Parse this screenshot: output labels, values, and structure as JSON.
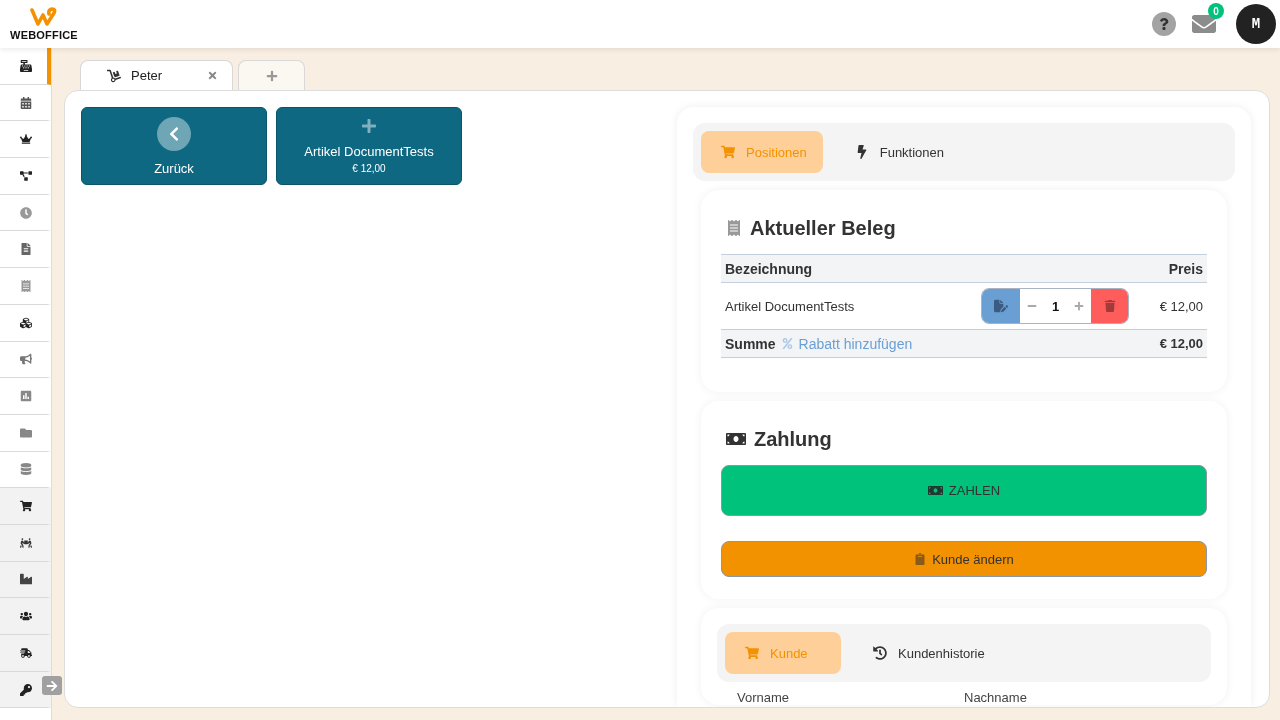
{
  "header": {
    "logo_text": "WEBOFFICE",
    "notification_count": "0",
    "avatar_initial": "M"
  },
  "sidebar": {
    "items": [
      {
        "selected": true,
        "shaded": false
      },
      {
        "selected": false,
        "shaded": false
      },
      {
        "selected": false,
        "shaded": false
      },
      {
        "selected": false,
        "shaded": false
      },
      {
        "selected": false,
        "shaded": false
      },
      {
        "selected": false,
        "shaded": false
      },
      {
        "selected": false,
        "shaded": false
      },
      {
        "selected": false,
        "shaded": false
      },
      {
        "selected": false,
        "shaded": false
      },
      {
        "selected": false,
        "shaded": false
      },
      {
        "selected": false,
        "shaded": false
      },
      {
        "selected": false,
        "shaded": false
      },
      {
        "selected": false,
        "shaded": true
      },
      {
        "selected": false,
        "shaded": true
      },
      {
        "selected": false,
        "shaded": true
      },
      {
        "selected": false,
        "shaded": true
      },
      {
        "selected": false,
        "shaded": true
      },
      {
        "selected": false,
        "shaded": true
      }
    ]
  },
  "tabs": [
    {
      "label": "Peter",
      "selected": true
    }
  ],
  "tiles": [
    {
      "kind": "back",
      "label": "Zurück"
    },
    {
      "kind": "article",
      "label": "Artikel DocumentTests",
      "price": "€ 12,00"
    }
  ],
  "panel_tabs": [
    {
      "label": "Positionen",
      "selected": true
    },
    {
      "label": "Funktionen",
      "selected": false
    }
  ],
  "receipt": {
    "title": "Aktueller Beleg",
    "columns": [
      "Bezeichnung",
      "Preis"
    ],
    "rows": [
      {
        "name": "Artikel DocumentTests",
        "quantity": "1",
        "price": "€ 12,00"
      }
    ],
    "total_label": "Summe",
    "discount_link": "Rabatt hinzufügen",
    "total": "€ 12,00"
  },
  "payment": {
    "title": "Zahlung",
    "pay_button": "ZAHLEN",
    "customer_button": "Kunde ändern"
  },
  "customer": {
    "tabs": [
      {
        "label": "Kunde",
        "selected": true
      },
      {
        "label": "Kundenhistorie",
        "selected": false
      }
    ],
    "fields": [
      "Vorname",
      "Nachname"
    ]
  }
}
